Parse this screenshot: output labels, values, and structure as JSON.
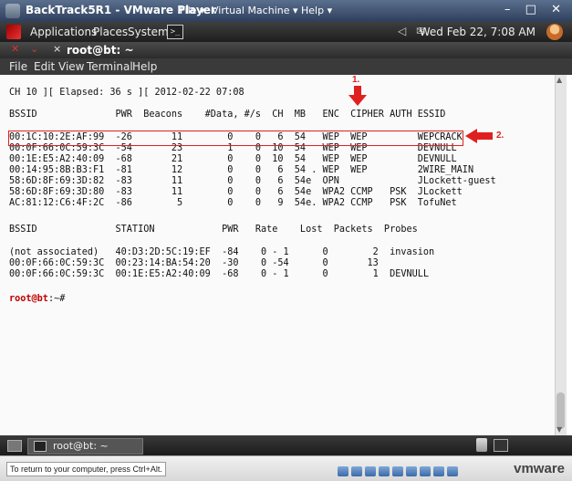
{
  "vmware": {
    "title": "BackTrack5R1 - VMware Player",
    "menus": [
      "File ▾",
      "Virtual Machine ▾",
      "Help ▾"
    ],
    "window_controls": "– □ ✕",
    "status_text": "To return to your computer, press Ctrl+Alt.",
    "brand": "vmware"
  },
  "panel": {
    "menus": [
      "Applications",
      "Places",
      "System"
    ],
    "launcher_glyph": ">_",
    "clock": "Wed Feb 22,  7:08 AM"
  },
  "terminal": {
    "title": "root@bt: ~",
    "menus": [
      "File",
      "Edit",
      "View",
      "Terminal",
      "Help"
    ],
    "lines": [
      "CH 10 ][ Elapsed: 36 s ][ 2012-02-22 07:08",
      "",
      "BSSID              PWR  Beacons    #Data, #/s  CH  MB   ENC  CIPHER AUTH ESSID",
      "",
      "00:1C:10:2E:AF:99  -26       11        0    0   6  54   WEP  WEP         WEPCRACK",
      "00:0F:66:0C:59:3C  -54       23        1    0  10  54   WEP  WEP         DEVNULL",
      "00:1E:E5:A2:40:09  -68       21        0    0  10  54   WEP  WEP         DEVNULL",
      "00:14:95:8B:B3:F1  -81       12        0    0   6  54 . WEP  WEP         2WIRE_MAIN",
      "58:6D:8F:69:3D:82  -83       11        0    0   6  54e  OPN              JLockett-guest",
      "58:6D:8F:69:3D:80  -83       11        0    0   6  54e  WPA2 CCMP   PSK  JLockett",
      "AC:81:12:C6:4F:2C  -86        5        0    0   9  54e. WPA2 CCMP   PSK  TofuNet",
      "",
      "BSSID              STATION            PWR   Rate    Lost  Packets  Probes",
      "",
      "(not associated)   40:D3:2D:5C:19:EF  -84    0 - 1      0        2  invasion",
      "00:0F:66:0C:59:3C  00:23:14:BA:54:20  -30    0 -54      0       13",
      "00:0F:66:0C:59:3C  00:1E:E5:A2:40:09  -68    0 - 1      0        1  DEVNULL",
      ""
    ],
    "prompt_user": "root@bt",
    "prompt_rest": ":~#"
  },
  "annotations": {
    "label_1": "1.",
    "label_2": "2.",
    "color": "#e02020"
  },
  "taskbar": {
    "task_label": "root@bt: ~"
  }
}
